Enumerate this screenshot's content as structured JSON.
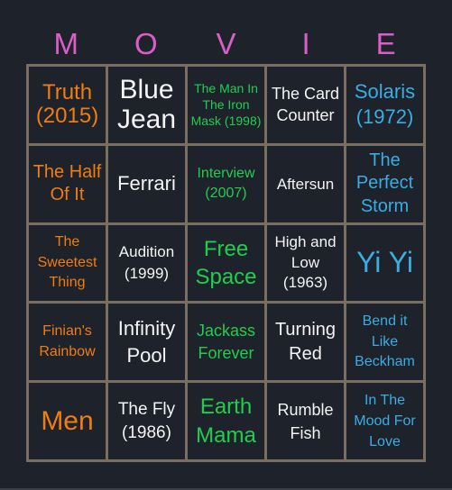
{
  "header": {
    "letters": [
      "M",
      "O",
      "V",
      "I",
      "E"
    ]
  },
  "colors": {
    "header": "#d95fc6",
    "grid_line": "#7a6e60",
    "background": "#1e222b",
    "orange": "#f07d10",
    "white": "#f4f4f4",
    "green": "#1ecf4f",
    "blue": "#39ade4"
  },
  "cells": [
    {
      "text": "Truth (2015)",
      "color": "orange"
    },
    {
      "text": "Blue Jean",
      "color": "white"
    },
    {
      "text": "The Man In The Iron Mask (1998)",
      "color": "green"
    },
    {
      "text": "The Card Counter",
      "color": "white"
    },
    {
      "text": "Solaris (1972)",
      "color": "blue"
    },
    {
      "text": "The Half Of It",
      "color": "orange"
    },
    {
      "text": "Ferrari",
      "color": "white"
    },
    {
      "text": "Interview (2007)",
      "color": "green"
    },
    {
      "text": "Aftersun",
      "color": "white"
    },
    {
      "text": "The Perfect Storm",
      "color": "blue"
    },
    {
      "text": "The Sweetest Thing",
      "color": "orange"
    },
    {
      "text": "Audition (1999)",
      "color": "white"
    },
    {
      "text": "Free Space",
      "color": "green"
    },
    {
      "text": "High and Low (1963)",
      "color": "white"
    },
    {
      "text": "Yi Yi",
      "color": "blue"
    },
    {
      "text": "Finian's Rainbow",
      "color": "orange"
    },
    {
      "text": "Infinity Pool",
      "color": "white"
    },
    {
      "text": "Jackass Forever",
      "color": "green"
    },
    {
      "text": "Turning Red",
      "color": "white"
    },
    {
      "text": "Bend it Like Beckham",
      "color": "blue"
    },
    {
      "text": "Men",
      "color": "orange"
    },
    {
      "text": "The Fly (1986)",
      "color": "white"
    },
    {
      "text": "Earth Mama",
      "color": "green"
    },
    {
      "text": "Rumble Fish",
      "color": "white"
    },
    {
      "text": "In The Mood For Love",
      "color": "blue"
    }
  ]
}
